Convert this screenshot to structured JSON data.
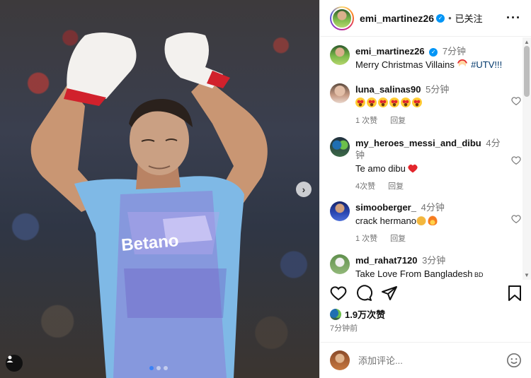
{
  "post": {
    "username": "emi_martinez26",
    "follow_status": "已关注",
    "likes": "1.9万次赞",
    "time": "7分钟前"
  },
  "comments": [
    {
      "username": "emi_martinez26",
      "time": "7分钟",
      "text": "Merry Christmas Villains",
      "emoji": [
        "santa"
      ],
      "tail": " #UTV!!!",
      "is_caption": true,
      "avatar": "green"
    },
    {
      "username": "luna_salinas90",
      "time": "5分钟",
      "text": "",
      "emoji": [
        "heart-eyes",
        "heart-eyes",
        "heart-eyes",
        "heart-eyes",
        "heart-eyes",
        "heart-eyes"
      ],
      "likes": "1 次赞",
      "reply": "回复",
      "avatar": "pink"
    },
    {
      "username": "my_heroes_messi_and_dibu",
      "time": "4分钟",
      "text": "Te amo dibu",
      "emoji": [
        "red-heart"
      ],
      "likes": "4次赞",
      "reply": "回复",
      "avatar": "team"
    },
    {
      "username": "simooberger_",
      "time": "4分钟",
      "text": "crack hermano",
      "emoji": [
        "pray",
        "fire"
      ],
      "likes": "1 次赞",
      "reply": "回复",
      "avatar": "blue"
    },
    {
      "username": "md_rahat7120",
      "time": "3分钟",
      "text": "Take Love From Bangladesh",
      "tail": " BD",
      "avatar": "field"
    }
  ],
  "input": {
    "placeholder": "添加评论..."
  },
  "icons": {
    "more": "more-options-icon",
    "verified": "verified-badge-icon",
    "like": "heart-icon",
    "comment": "comment-icon",
    "share": "share-icon",
    "save": "bookmark-icon",
    "emoji": "emoji-icon",
    "next": "chevron-right-icon",
    "tag": "user-tag-icon"
  },
  "colors": {
    "accent": "#0095f6",
    "heart_red": "#e3262c",
    "muted": "#737373"
  }
}
